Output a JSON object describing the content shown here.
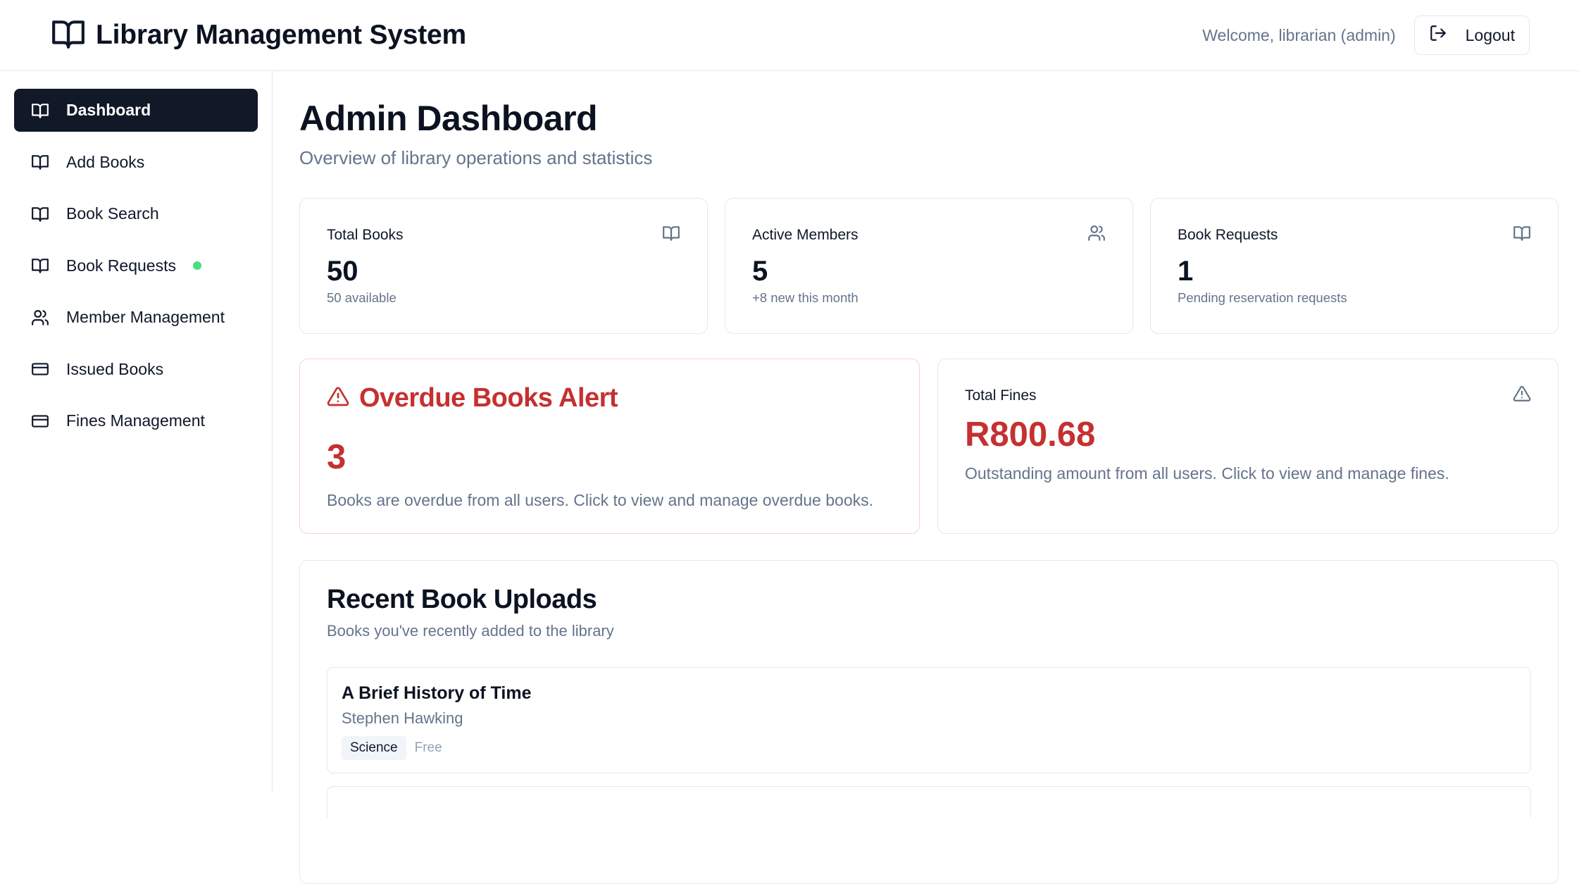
{
  "header": {
    "title": "Library Management System",
    "welcome": "Welcome, librarian (admin)",
    "logout_label": "Logout"
  },
  "sidebar": {
    "items": [
      {
        "label": "Dashboard",
        "icon": "book-open-icon",
        "active": true
      },
      {
        "label": "Add Books",
        "icon": "book-open-icon"
      },
      {
        "label": "Book Search",
        "icon": "book-open-icon"
      },
      {
        "label": "Book Requests",
        "icon": "book-open-icon",
        "indicator": "green-dot"
      },
      {
        "label": "Member Management",
        "icon": "users-icon"
      },
      {
        "label": "Issued Books",
        "icon": "credit-card-icon"
      },
      {
        "label": "Fines Management",
        "icon": "credit-card-icon"
      }
    ]
  },
  "main": {
    "title": "Admin Dashboard",
    "subtitle": "Overview of library operations and statistics",
    "stats": [
      {
        "label": "Total Books",
        "value": "50",
        "note": "50 available",
        "icon": "book-open-icon"
      },
      {
        "label": "Active Members",
        "value": "5",
        "note": "+8 new this month",
        "icon": "users-icon"
      },
      {
        "label": "Book Requests",
        "value": "1",
        "note": "Pending reservation requests",
        "icon": "book-open-icon"
      }
    ],
    "overdue": {
      "title": "Overdue Books Alert",
      "value": "3",
      "description": "Books are overdue from all users. Click to view and manage overdue books.",
      "icon": "alert-triangle-icon"
    },
    "fines": {
      "label": "Total Fines",
      "value": "R800.68",
      "description": "Outstanding amount from all users. Click to view and manage fines.",
      "icon": "alert-triangle-icon"
    },
    "recent": {
      "title": "Recent Book Uploads",
      "subtitle": "Books you've recently added to the library",
      "books": [
        {
          "title": "A Brief History of Time",
          "author": "Stephen Hawking",
          "category": "Science",
          "price": "Free"
        }
      ]
    }
  },
  "colors": {
    "accent_dark": "#111827",
    "danger": "#c53030",
    "muted": "#64748b",
    "status_green": "#4ade80"
  }
}
